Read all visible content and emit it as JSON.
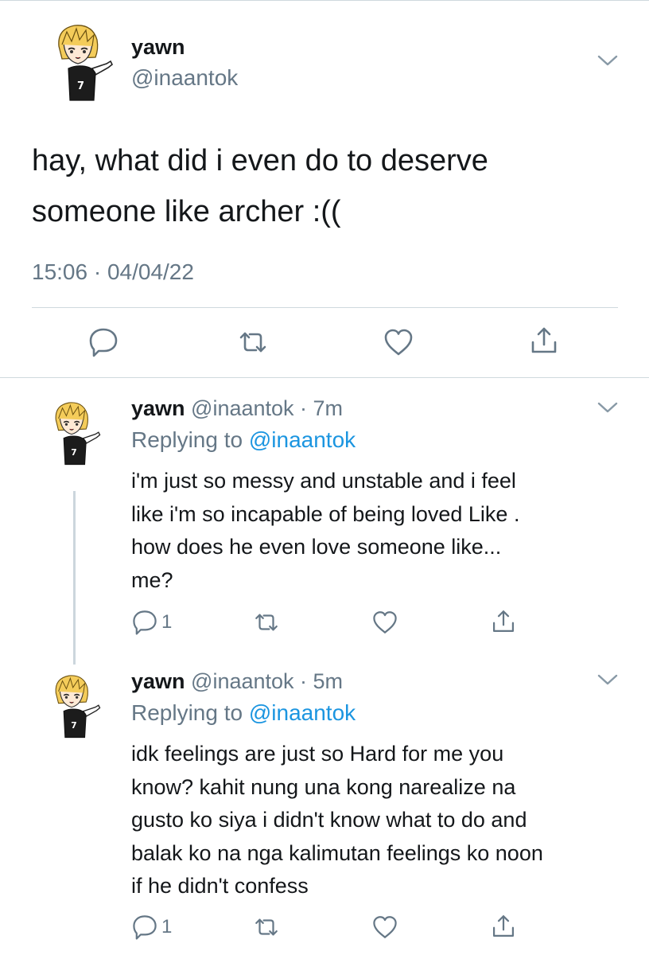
{
  "main_tweet": {
    "display_name": "yawn",
    "handle": "@inaantok",
    "text": "hay, what did i even do to deserve someone like archer :((",
    "timestamp": "15:06 · 04/04/22",
    "actions": [
      "reply-icon",
      "retweet-icon",
      "like-icon",
      "share-icon"
    ]
  },
  "replies": [
    {
      "display_name": "yawn",
      "handle_time": "@inaantok · 7m",
      "replying_prefix": "Replying to",
      "replying_to": "@inaantok",
      "lines": [
        "i'm just so messy and unstable and i feel",
        "like i'm so incapable of being loved Like .",
        "how does he even love someone like...",
        "me?"
      ],
      "reply_count": "1"
    },
    {
      "display_name": "yawn",
      "handle_time": "@inaantok · 5m",
      "replying_prefix": "Replying to",
      "replying_to": "@inaantok",
      "lines": [
        "idk feelings are just so Hard for me you",
        "know? kahit nung una kong narealize na",
        "gusto ko siya i didn't know what to do and",
        "balak ko na nga kalimutan feelings ko noon",
        "if he didn't confess"
      ],
      "reply_count": "1"
    }
  ],
  "colors": {
    "text": "#14171a",
    "secondary": "#657786",
    "link": "#1b95e0",
    "divider": "#cfd9de",
    "thread": "#ccd6dd"
  }
}
